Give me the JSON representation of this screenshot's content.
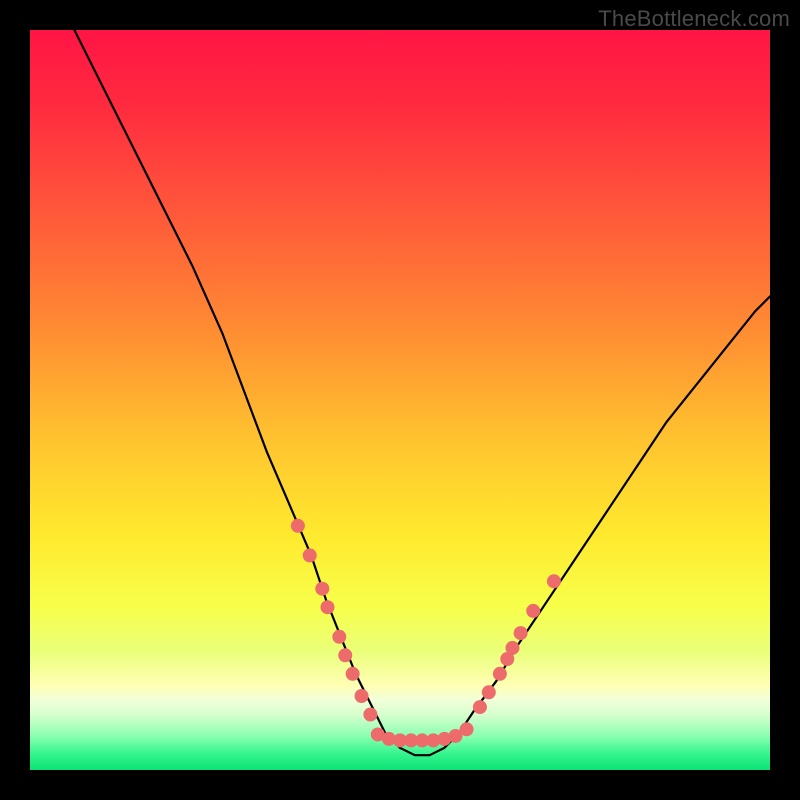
{
  "watermark": "TheBottleneck.com",
  "chart_data": {
    "type": "line",
    "title": "",
    "xlabel": "",
    "ylabel": "",
    "xlim": [
      0,
      100
    ],
    "ylim": [
      0,
      100
    ],
    "grid": false,
    "legend": false,
    "annotations": [],
    "gradient_stops": [
      {
        "offset": 0.0,
        "color": "#ff1545"
      },
      {
        "offset": 0.1,
        "color": "#ff2a3f"
      },
      {
        "offset": 0.25,
        "color": "#ff593a"
      },
      {
        "offset": 0.4,
        "color": "#ff8a33"
      },
      {
        "offset": 0.55,
        "color": "#ffc22f"
      },
      {
        "offset": 0.68,
        "color": "#ffe92e"
      },
      {
        "offset": 0.78,
        "color": "#f7ff4a"
      },
      {
        "offset": 0.84,
        "color": "#eaff7a"
      },
      {
        "offset": 0.885,
        "color": "#ffffb3"
      },
      {
        "offset": 0.905,
        "color": "#f2ffd9"
      },
      {
        "offset": 0.925,
        "color": "#d7ffce"
      },
      {
        "offset": 0.955,
        "color": "#88ffb0"
      },
      {
        "offset": 0.978,
        "color": "#35f58d"
      },
      {
        "offset": 1.0,
        "color": "#0be276"
      }
    ],
    "series": [
      {
        "name": "bottleneck-curve",
        "color": "#000000",
        "x": [
          6,
          10,
          14,
          18,
          22,
          26,
          29,
          32,
          35,
          38,
          40,
          42,
          44,
          46,
          48,
          50,
          52,
          54,
          56,
          58,
          60,
          63,
          66,
          70,
          74,
          78,
          82,
          86,
          90,
          94,
          98,
          100
        ],
        "y": [
          100,
          92,
          84,
          76,
          68,
          59,
          51,
          43,
          36,
          29,
          23,
          18,
          13,
          9,
          5,
          3,
          2,
          2,
          3,
          5,
          8,
          12,
          17,
          23,
          29,
          35,
          41,
          47,
          52,
          57,
          62,
          64
        ]
      }
    ],
    "scatter": [
      {
        "name": "curve-dots",
        "color": "#ed6b6b",
        "radius": 7,
        "points": [
          {
            "x": 36.2,
            "y": 33
          },
          {
            "x": 37.8,
            "y": 29
          },
          {
            "x": 39.5,
            "y": 24.5
          },
          {
            "x": 40.2,
            "y": 22
          },
          {
            "x": 41.8,
            "y": 18
          },
          {
            "x": 42.6,
            "y": 15.5
          },
          {
            "x": 43.6,
            "y": 13
          },
          {
            "x": 44.8,
            "y": 10
          },
          {
            "x": 46.0,
            "y": 7.5
          },
          {
            "x": 60.8,
            "y": 8.5
          },
          {
            "x": 62.0,
            "y": 10.5
          },
          {
            "x": 63.5,
            "y": 13
          },
          {
            "x": 64.5,
            "y": 15
          },
          {
            "x": 65.2,
            "y": 16.5
          },
          {
            "x": 66.3,
            "y": 18.5
          },
          {
            "x": 68.0,
            "y": 21.5
          },
          {
            "x": 70.8,
            "y": 25.5
          }
        ]
      },
      {
        "name": "curve-bottom-bar",
        "color": "#ed6b6b",
        "radius": 7,
        "points": [
          {
            "x": 47,
            "y": 4.8
          },
          {
            "x": 48.5,
            "y": 4.2
          },
          {
            "x": 50,
            "y": 4.0
          },
          {
            "x": 51.5,
            "y": 4.0
          },
          {
            "x": 53,
            "y": 4.0
          },
          {
            "x": 54.5,
            "y": 4.0
          },
          {
            "x": 56,
            "y": 4.2
          },
          {
            "x": 57.5,
            "y": 4.6
          },
          {
            "x": 59,
            "y": 5.5
          }
        ]
      }
    ]
  }
}
